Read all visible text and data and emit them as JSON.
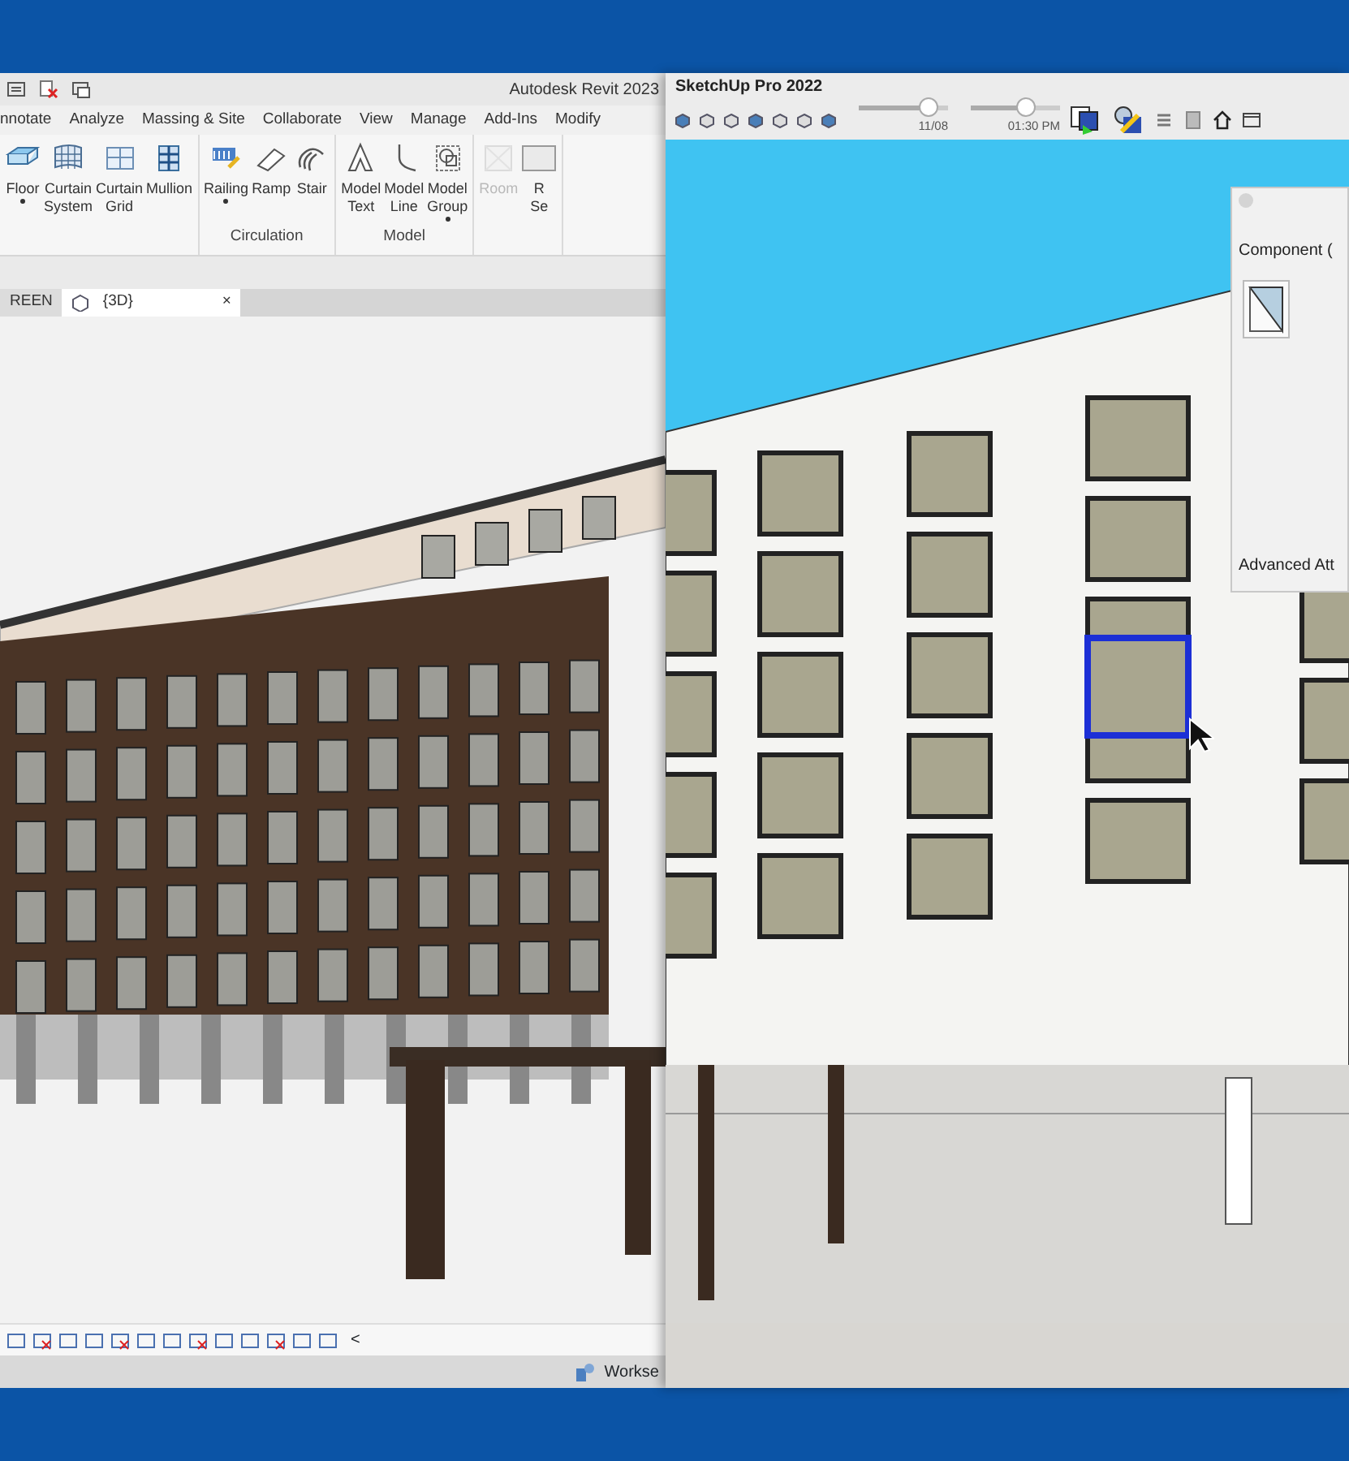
{
  "revit": {
    "title": "Autodesk Revit 2023",
    "ribbon_tabs": [
      "nnotate",
      "Analyze",
      "Massing & Site",
      "Collaborate",
      "View",
      "Manage",
      "Add-Ins",
      "Modify"
    ],
    "ribbon_panels": [
      {
        "items": [
          {
            "label": [
              "Floor"
            ],
            "dropdown": true,
            "disabled": false
          },
          {
            "label": [
              "Curtain",
              "System"
            ],
            "dropdown": false,
            "disabled": false
          },
          {
            "label": [
              "Curtain",
              "Grid"
            ],
            "dropdown": false,
            "disabled": false
          },
          {
            "label": [
              "Mullion"
            ],
            "dropdown": false,
            "disabled": false
          }
        ]
      },
      {
        "label": "Circulation",
        "items": [
          {
            "label": [
              "Railing"
            ],
            "dropdown": true,
            "disabled": false
          },
          {
            "label": [
              "Ramp"
            ],
            "dropdown": false,
            "disabled": false
          },
          {
            "label": [
              "Stair"
            ],
            "dropdown": false,
            "disabled": false
          }
        ]
      },
      {
        "label": "Model",
        "items": [
          {
            "label": [
              "Model",
              "Text"
            ],
            "dropdown": false,
            "disabled": false
          },
          {
            "label": [
              "Model",
              "Line"
            ],
            "dropdown": false,
            "disabled": false
          },
          {
            "label": [
              "Model",
              "Group"
            ],
            "dropdown": true,
            "disabled": false
          }
        ]
      },
      {
        "items": [
          {
            "label": [
              "Room"
            ],
            "dropdown": false,
            "disabled": true
          },
          {
            "label": [
              "R",
              "Se"
            ],
            "dropdown": false,
            "disabled": false
          }
        ]
      }
    ],
    "view_tabs": [
      {
        "label": "REEN",
        "selected": false
      },
      {
        "label": "{3D}",
        "selected": true,
        "close": "×"
      }
    ],
    "view_bar": {
      "more": "<"
    },
    "status_bar": {
      "text": "Workse"
    }
  },
  "sketchup": {
    "title": "SketchUp Pro 2022",
    "sliders": [
      {
        "level": 0.78,
        "reading": "11/08"
      },
      {
        "level": 0.62,
        "reading": "01:30 PM"
      }
    ],
    "component_panel": {
      "title": "Component (",
      "footer": "Advanced Att"
    }
  }
}
